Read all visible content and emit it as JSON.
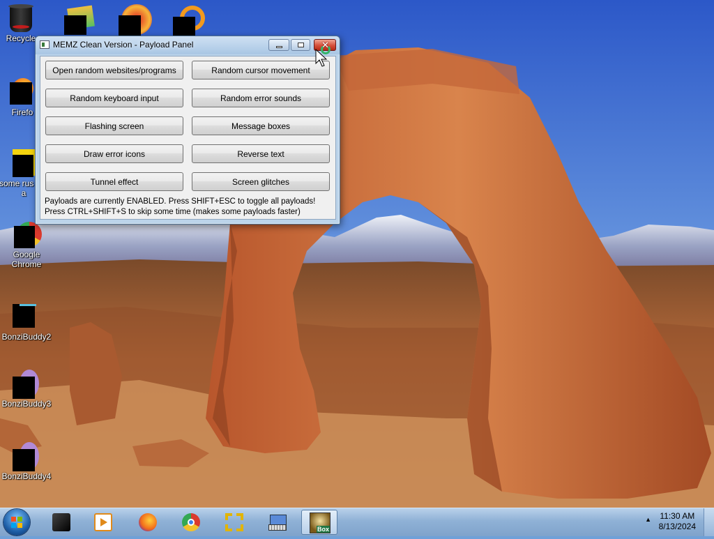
{
  "desktop": {
    "icons": [
      {
        "label": "Recycle"
      },
      {
        "label": "Firefo"
      },
      {
        "label": "some rus ran a"
      },
      {
        "label": "Google Chrome"
      },
      {
        "label": "BonziBuddy2"
      },
      {
        "label": "BonziBuddy3"
      },
      {
        "label": "BonziBuddy4"
      }
    ]
  },
  "window": {
    "title": "MEMZ Clean Version - Payload Panel",
    "buttons": {
      "open_random": "Open random websites/programs",
      "random_cursor": "Random cursor movement",
      "random_keyboard": "Random keyboard input",
      "random_error_sounds": "Random error sounds",
      "flashing_screen": "Flashing screen",
      "message_boxes": "Message boxes",
      "draw_error_icons": "Draw error icons",
      "reverse_text": "Reverse text",
      "tunnel_effect": "Tunnel effect",
      "screen_glitches": "Screen glitches"
    },
    "status_line_1": "Payloads are currently ENABLED. Press SHIFT+ESC to toggle all payloads!",
    "status_line_2": "Press CTRL+SHIFT+S to skip some time (makes some payloads faster)"
  },
  "taskbar": {
    "bonzi_label": "Box",
    "clock_time": "11:30 AM",
    "clock_date": "8/13/2024"
  }
}
